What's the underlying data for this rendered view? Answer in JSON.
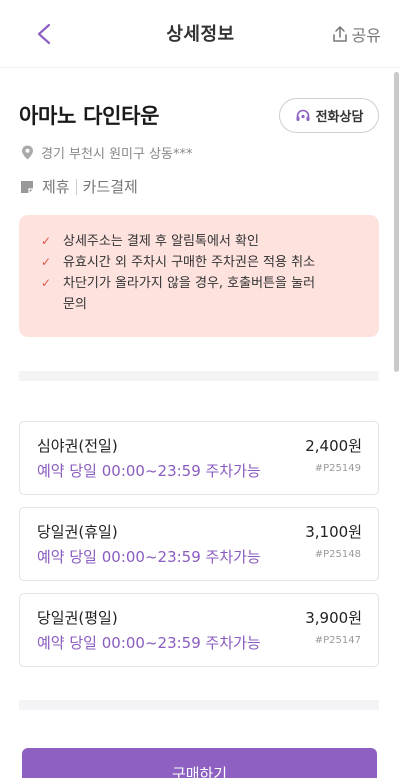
{
  "header": {
    "title": "상세정보",
    "share_label": "공유"
  },
  "place": {
    "name": "아마노 다인타운",
    "call_label": "전화상담",
    "address": "경기 부천시 원미구 상동***",
    "tags": [
      "제휴",
      "카드결제"
    ]
  },
  "notices": [
    "상세주소는 결제 후 알림톡에서 확인",
    "유효시간 외 주차시 구매한 주차권은 적용 취소",
    "차단기가 올라가지 않을 경우, 호출버튼을 눌러",
    "문의"
  ],
  "tickets": [
    {
      "name": "심야권(전일)",
      "desc": "예약 당일 00:00~23:59 주차가능",
      "price": "2,400원",
      "code": "#P25149"
    },
    {
      "name": "당일권(휴일)",
      "desc": "예약 당일 00:00~23:59 주차가능",
      "price": "3,100원",
      "code": "#P25148"
    },
    {
      "name": "당일권(평일)",
      "desc": "예약 당일 00:00~23:59 주차가능",
      "price": "3,900원",
      "code": "#P25147"
    }
  ],
  "buy_label": "구매하기",
  "colors": {
    "accent": "#8d60c2",
    "notice_bg": "#fde2de",
    "check": "#e1574a"
  }
}
